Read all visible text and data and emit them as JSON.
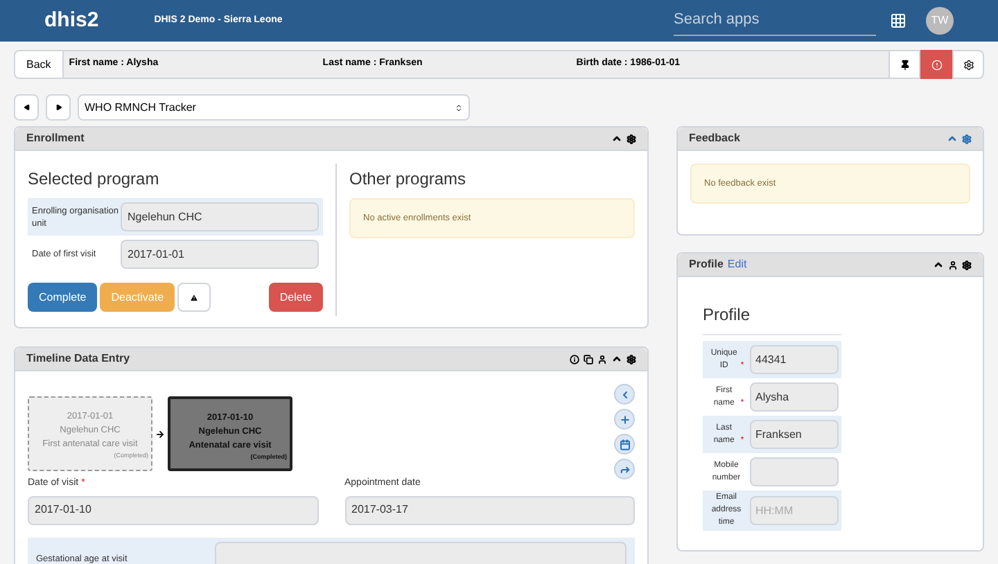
{
  "header": {
    "logo": "dhis2",
    "title": "DHIS 2 Demo - Sierra Leone",
    "search": {
      "placeholder": "Search apps"
    },
    "avatar": "TW"
  },
  "patient_bar": {
    "back": "Back",
    "fields": [
      "First name : Alysha",
      "Last name : Franksen",
      "Birth date : 1986-01-01"
    ]
  },
  "program_select": {
    "value": "WHO RMNCH Tracker"
  },
  "enrollment": {
    "title": "Enrollment",
    "selected_title": "Selected program",
    "fields": [
      {
        "label": "Enrolling organisation unit",
        "value": "Ngelehun CHC"
      },
      {
        "label": "Date of first visit",
        "value": "2017-01-01"
      }
    ],
    "buttons": [
      {
        "label": "Complete",
        "kind": "primary"
      },
      {
        "label": "Deactivate",
        "kind": "warning"
      },
      {
        "kind": "icon"
      },
      {
        "label": "Delete",
        "kind": "danger"
      }
    ],
    "other_title": "Other programs",
    "other_message": "No active enrollments exist"
  },
  "timeline": {
    "title": "Timeline Data Entry",
    "events": [
      {
        "date": "2017-01-01",
        "org_unit": "Ngelehun CHC",
        "stage": "First antenatal care visit",
        "status": "(Completed)",
        "selected": false
      },
      {
        "date": "2017-01-10",
        "org_unit": "Ngelehun CHC",
        "stage": "Antenatal care visit",
        "status": "(Completed)",
        "selected": true
      }
    ],
    "date_of_visit": {
      "label": "Date of visit",
      "required_mark": "*",
      "value": "2017-01-10"
    },
    "appointment": {
      "label": "Appointment date",
      "value": "2017-03-17"
    },
    "row_label": "Gestational age at visit"
  },
  "feedback": {
    "title": "Feedback",
    "message": "No feedback exist"
  },
  "profile": {
    "title": "Profile",
    "edit": "Edit",
    "heading": "Profile",
    "fields": [
      {
        "label": "Unique ID",
        "required_mark": "*",
        "value": "44341"
      },
      {
        "label": "First name",
        "required_mark": "*",
        "value": "Alysha"
      },
      {
        "label": "Last name",
        "required_mark": "*",
        "value": "Franksen"
      },
      {
        "label": "Mobile number"
      },
      {
        "label": "Email address time",
        "placeholder": "HH:MM"
      }
    ]
  }
}
